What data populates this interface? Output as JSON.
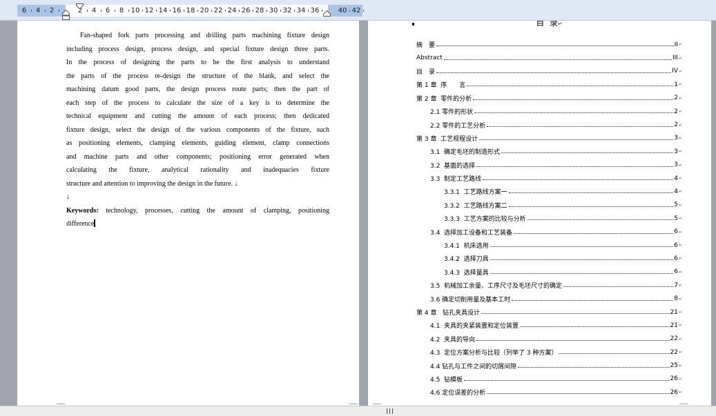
{
  "ruler": {
    "left_numbers": [
      "6",
      "4",
      "2"
    ],
    "main_numbers": [
      "2",
      "4",
      "6",
      "8",
      "10",
      "12",
      "14",
      "16",
      "18",
      "20",
      "22",
      "24",
      "26",
      "28",
      "30",
      "32",
      "34",
      "36"
    ],
    "right_numbers": [
      "40",
      "42"
    ],
    "icons": {
      "first_line_indent": "first-line-indent-icon",
      "hanging_indent": "hanging-indent-icon",
      "right_indent": "right-indent-icon"
    }
  },
  "left_page": {
    "abstract_lines": [
      "Fan-shaped fork parts processing and drilling parts machining fixture design",
      "including process design, process design, and special fixture design three parts.",
      "In the process of designing the parts to be the first analysis to understand",
      "the parts of the process re-design the structure of the blank, and select the",
      "machining datum good parts, the design process route parts; then the part of",
      "each step of the process to calculate the size of a key is to determine the",
      "technical equipment and cutting the amount of each process; then dedicated",
      "fixture design, select the design of the various components of the fixture, such",
      "as positioning elements, clamping elements, guiding element, clamp connections",
      "and machine parts and other components; positioning error generated when",
      "calculating the fixture, analytical rationality and inadequacies fixture",
      "structure and attention to improving the design in the future. ↓"
    ],
    "blank_paragraph": "↓",
    "keywords_label": "Keywords:",
    "keywords_text": " technology, processes, cutting the amount of clamping, positioning",
    "keywords_continuation": "difference"
  },
  "right_page": {
    "title": "目  录",
    "title_mark": "↵",
    "para_mark": "↵",
    "toc": [
      {
        "label": "摘　要",
        "page": "II",
        "level": 1
      },
      {
        "label": "Abstract",
        "page": "III",
        "level": 1
      },
      {
        "label": "目　录",
        "page": "IV",
        "level": 1
      },
      {
        "label": "第 1 章  序　　言",
        "page": "1",
        "level": 1
      },
      {
        "label": "第 2 章  零件的分析",
        "page": "2",
        "level": 1
      },
      {
        "label": "2.1 零件的形状",
        "page": "2",
        "level": 2
      },
      {
        "label": "2.2 零件的工艺分析",
        "page": "2",
        "level": 2
      },
      {
        "label": "第 3 章  工艺规程设计",
        "page": "3",
        "level": 1
      },
      {
        "label": "3.1  确定毛坯的制造形式",
        "page": "3",
        "level": 2
      },
      {
        "label": "3.2  基面的选择",
        "page": "3",
        "level": 2
      },
      {
        "label": "3.3  制定工艺路线",
        "page": "4",
        "level": 2
      },
      {
        "label": "3.3.1  工艺路线方案一",
        "page": "4",
        "level": 3
      },
      {
        "label": "3.3.2  工艺路线方案二",
        "page": "5",
        "level": 3
      },
      {
        "label": "3.3.3  工艺方案的比较与分析",
        "page": "5",
        "level": 3
      },
      {
        "label": "3.4  选择加工设备和工艺装备",
        "page": "6",
        "level": 2
      },
      {
        "label": "3.4.1  机床选用",
        "page": "6",
        "level": 3
      },
      {
        "label": "3.4.2  选择刀具",
        "page": "6",
        "level": 3
      },
      {
        "label": "3.4.3  选择量具",
        "page": "6",
        "level": 3
      },
      {
        "label": "3.5  机械加工余量、工序尺寸及毛坯尺寸的确定",
        "page": "7",
        "level": 2
      },
      {
        "label": "3.6 确定切削用量及基本工时",
        "page": "8",
        "level": 2
      },
      {
        "label": "第 4 章   钻孔夹具设计",
        "page": "21",
        "level": 1
      },
      {
        "label": "4.1  夹具的夹紧装置和定位装置",
        "page": "21",
        "level": 2
      },
      {
        "label": "4.2  夹具的导向",
        "page": "22",
        "level": 2
      },
      {
        "label": "4.3  定位方案分析与比较（列举了 3 种方案）",
        "page": "22",
        "level": 2
      },
      {
        "label": "4.4 钻孔与工件之间的切屑间隙",
        "page": "25",
        "level": 2
      },
      {
        "label": "4.5  钻模板",
        "page": "26",
        "level": 2
      },
      {
        "label": "4.6 定位误差的分析",
        "page": "26",
        "level": 2
      }
    ]
  },
  "scrollbar": {
    "grip_icon": "scroll-grip-icon"
  },
  "colors": {
    "ruler_margin": "#a9c4e6",
    "ruler_text_area": "#ffffff",
    "workspace": "#a0a4ac",
    "page": "#ffffff",
    "text": "#000000"
  }
}
